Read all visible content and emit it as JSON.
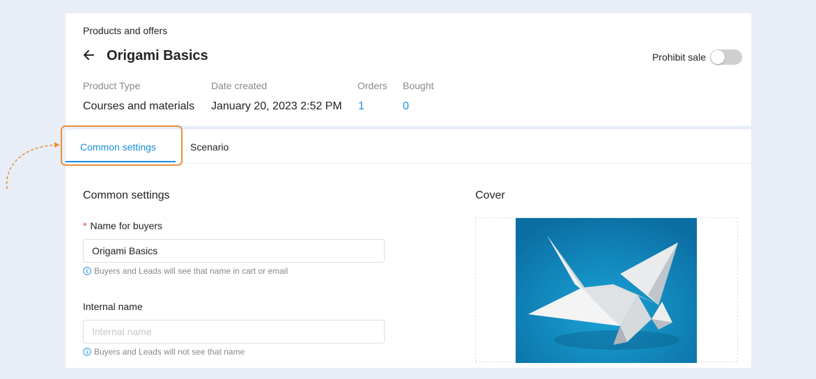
{
  "header": {
    "breadcrumb": "Products and offers",
    "title": "Origami Basics",
    "prohibit_label": "Prohibit sale",
    "prohibit_on": false
  },
  "meta": {
    "product_type_label": "Product Type",
    "product_type_value": "Courses and materials",
    "date_label": "Date created",
    "date_value": "January 20, 2023 2:52 PM",
    "orders_label": "Orders",
    "orders_value": "1",
    "bought_label": "Bought",
    "bought_value": "0"
  },
  "tabs": [
    {
      "label": "Common settings",
      "active": true
    },
    {
      "label": "Scenario",
      "active": false
    }
  ],
  "form": {
    "section_title": "Common settings",
    "name_label": "Name for buyers",
    "name_value": "Origami Basics",
    "name_hint": "Buyers and Leads will see that name in cart or email",
    "internal_label": "Internal name",
    "internal_placeholder": "Internal name",
    "internal_value": "",
    "internal_hint": "Buyers and Leads will not see that name"
  },
  "cover": {
    "title": "Cover"
  },
  "colors": {
    "accent": "#1a8fe3",
    "highlight": "#e8903a",
    "required": "#e2462b",
    "cover_bg": "#0f80b8"
  }
}
